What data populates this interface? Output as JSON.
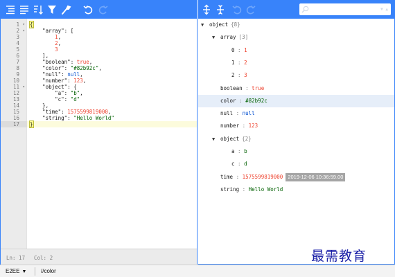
{
  "editor": {
    "toolbar": [
      {
        "name": "format-icon"
      },
      {
        "name": "compact-icon"
      },
      {
        "name": "sort-icon"
      },
      {
        "name": "filter-icon"
      },
      {
        "name": "repair-icon"
      },
      {
        "name": "undo-icon"
      },
      {
        "name": "redo-icon"
      }
    ],
    "gutter": [
      {
        "num": "1",
        "fold": "▾"
      },
      {
        "num": "2",
        "fold": "▾"
      },
      {
        "num": "3",
        "fold": ""
      },
      {
        "num": "4",
        "fold": ""
      },
      {
        "num": "5",
        "fold": ""
      },
      {
        "num": "6",
        "fold": ""
      },
      {
        "num": "7",
        "fold": ""
      },
      {
        "num": "8",
        "fold": ""
      },
      {
        "num": "9",
        "fold": ""
      },
      {
        "num": "10",
        "fold": ""
      },
      {
        "num": "11",
        "fold": "▾"
      },
      {
        "num": "12",
        "fold": ""
      },
      {
        "num": "13",
        "fold": ""
      },
      {
        "num": "14",
        "fold": ""
      },
      {
        "num": "15",
        "fold": ""
      },
      {
        "num": "16",
        "fold": ""
      },
      {
        "num": "17",
        "fold": ""
      }
    ],
    "lines": [
      [
        {
          "t": "{",
          "c": "tok-hl"
        }
      ],
      [
        {
          "t": "    \"array\"",
          "c": "tok-key"
        },
        {
          "t": ": [",
          "c": "tok-pun"
        }
      ],
      [
        {
          "t": "        1",
          "c": "tok-num"
        },
        {
          "t": ",",
          "c": "tok-pun"
        }
      ],
      [
        {
          "t": "        2",
          "c": "tok-num"
        },
        {
          "t": ",",
          "c": "tok-pun"
        }
      ],
      [
        {
          "t": "        3",
          "c": "tok-num"
        }
      ],
      [
        {
          "t": "    ],",
          "c": "tok-pun"
        }
      ],
      [
        {
          "t": "    \"boolean\"",
          "c": "tok-key"
        },
        {
          "t": ": ",
          "c": "tok-pun"
        },
        {
          "t": "true",
          "c": "tok-bool"
        },
        {
          "t": ",",
          "c": "tok-pun"
        }
      ],
      [
        {
          "t": "    \"color\"",
          "c": "tok-key"
        },
        {
          "t": ": ",
          "c": "tok-pun"
        },
        {
          "t": "\"#82b92c\"",
          "c": "tok-str"
        },
        {
          "t": ",",
          "c": "tok-pun"
        }
      ],
      [
        {
          "t": "    \"null\"",
          "c": "tok-key"
        },
        {
          "t": ": ",
          "c": "tok-pun"
        },
        {
          "t": "null",
          "c": "tok-null"
        },
        {
          "t": ",",
          "c": "tok-pun"
        }
      ],
      [
        {
          "t": "    \"number\"",
          "c": "tok-key"
        },
        {
          "t": ": ",
          "c": "tok-pun"
        },
        {
          "t": "123",
          "c": "tok-num"
        },
        {
          "t": ",",
          "c": "tok-pun"
        }
      ],
      [
        {
          "t": "    \"object\"",
          "c": "tok-key"
        },
        {
          "t": ": {",
          "c": "tok-pun"
        }
      ],
      [
        {
          "t": "        \"a\"",
          "c": "tok-key"
        },
        {
          "t": ": ",
          "c": "tok-pun"
        },
        {
          "t": "\"b\"",
          "c": "tok-str"
        },
        {
          "t": ",",
          "c": "tok-pun"
        }
      ],
      [
        {
          "t": "        \"c\"",
          "c": "tok-key"
        },
        {
          "t": ": ",
          "c": "tok-pun"
        },
        {
          "t": "\"d\"",
          "c": "tok-str"
        }
      ],
      [
        {
          "t": "    },",
          "c": "tok-pun"
        }
      ],
      [
        {
          "t": "    \"time\"",
          "c": "tok-key"
        },
        {
          "t": ": ",
          "c": "tok-pun"
        },
        {
          "t": "1575599819000",
          "c": "tok-num"
        },
        {
          "t": ",",
          "c": "tok-pun"
        }
      ],
      [
        {
          "t": "    \"string\"",
          "c": "tok-key"
        },
        {
          "t": ": ",
          "c": "tok-pun"
        },
        {
          "t": "\"Hello World\"",
          "c": "tok-str"
        }
      ],
      [
        {
          "t": "}",
          "c": "tok-hl"
        }
      ]
    ],
    "active_line": 17,
    "status": {
      "line": "Ln: 17",
      "col": "Col: 2"
    }
  },
  "tree": {
    "toolbar": [
      {
        "name": "expand-all-icon"
      },
      {
        "name": "collapse-all-icon"
      },
      {
        "name": "undo-icon"
      },
      {
        "name": "redo-icon"
      }
    ],
    "search": {
      "value": "",
      "placeholder": ""
    },
    "rows": [
      {
        "depth": 0,
        "arrow": "▼",
        "key": "object",
        "count": "{8}",
        "sep": "",
        "value": "",
        "vclass": "",
        "date": "",
        "selected": false
      },
      {
        "depth": 1,
        "arrow": "▼",
        "key": "array",
        "count": "[3]",
        "sep": "",
        "value": "",
        "vclass": "",
        "date": "",
        "selected": false
      },
      {
        "depth": 2,
        "arrow": "",
        "key": "0",
        "count": "",
        "sep": " : ",
        "value": "1",
        "vclass": "vnum",
        "date": "",
        "selected": false
      },
      {
        "depth": 2,
        "arrow": "",
        "key": "1",
        "count": "",
        "sep": " : ",
        "value": "2",
        "vclass": "vnum",
        "date": "",
        "selected": false
      },
      {
        "depth": 2,
        "arrow": "",
        "key": "2",
        "count": "",
        "sep": " : ",
        "value": "3",
        "vclass": "vnum",
        "date": "",
        "selected": false
      },
      {
        "depth": 1,
        "arrow": "",
        "key": "boolean",
        "count": "",
        "sep": " : ",
        "value": "true",
        "vclass": "vbool",
        "date": "",
        "selected": false
      },
      {
        "depth": 1,
        "arrow": "",
        "key": "color",
        "count": "",
        "sep": " : ",
        "value": "#82b92c",
        "vclass": "vstr",
        "date": "",
        "selected": true
      },
      {
        "depth": 1,
        "arrow": "",
        "key": "null",
        "count": "",
        "sep": " : ",
        "value": "null",
        "vclass": "vnull",
        "date": "",
        "selected": false
      },
      {
        "depth": 1,
        "arrow": "",
        "key": "number",
        "count": "",
        "sep": " : ",
        "value": "123",
        "vclass": "vnum",
        "date": "",
        "selected": false
      },
      {
        "depth": 1,
        "arrow": "▼",
        "key": "object",
        "count": "{2}",
        "sep": "",
        "value": "",
        "vclass": "",
        "date": "",
        "selected": false
      },
      {
        "depth": 2,
        "arrow": "",
        "key": "a",
        "count": "",
        "sep": " : ",
        "value": "b",
        "vclass": "vstr",
        "date": "",
        "selected": false
      },
      {
        "depth": 2,
        "arrow": "",
        "key": "c",
        "count": "",
        "sep": " : ",
        "value": "d",
        "vclass": "vstr",
        "date": "",
        "selected": false
      },
      {
        "depth": 1,
        "arrow": "",
        "key": "time",
        "count": "",
        "sep": " : ",
        "value": "1575599819000",
        "vclass": "vnum",
        "date": "2019-12-06 10:36:59.00",
        "selected": false
      },
      {
        "depth": 1,
        "arrow": "",
        "key": "string",
        "count": "",
        "sep": " : ",
        "value": "Hello World",
        "vclass": "vstr",
        "date": "",
        "selected": false
      }
    ]
  },
  "watermark": "最需教育",
  "bottom": {
    "mode": "E2EE",
    "query": "//color"
  },
  "colors": {
    "accent": "#3883fa",
    "string": "#006000",
    "number": "#ee422e",
    "null": "#004ed0"
  }
}
